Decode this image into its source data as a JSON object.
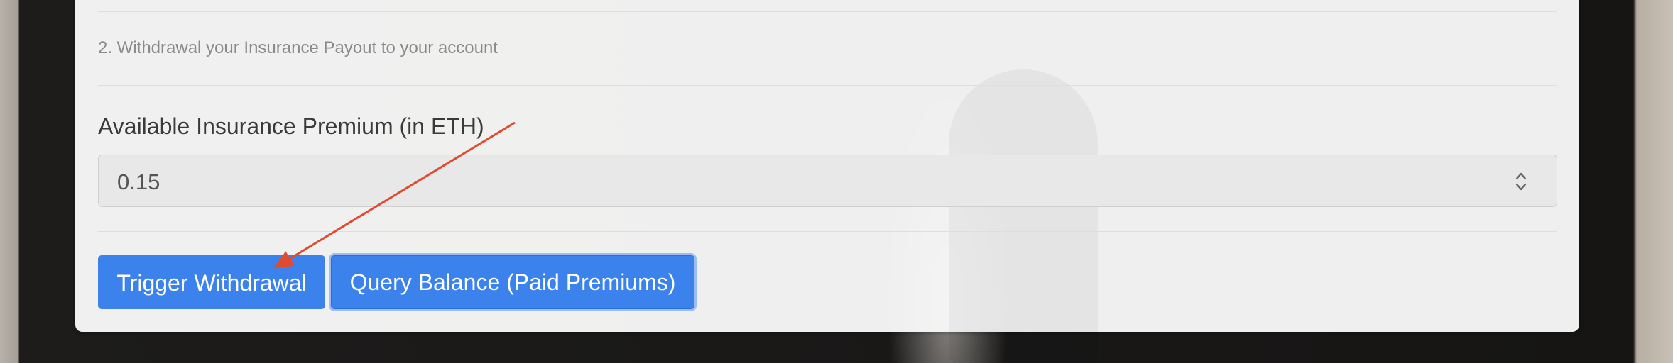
{
  "steps": {
    "step2_text": "2. Withdrawal your Insurance Payout to your account"
  },
  "premium": {
    "label": "Available Insurance Premium (in ETH)",
    "value": "0.15"
  },
  "actions": {
    "trigger_withdrawal_label": "Trigger Withdrawal",
    "query_balance_label": "Query Balance (Paid Premiums)"
  },
  "annotation": {
    "arrow_color": "#e04a2e",
    "target": "trigger-withdrawal-button"
  },
  "colors": {
    "primary_button": "#3b82ec",
    "panel_background": "#f8f8f8"
  },
  "icons": {
    "field_spinner": "chevron-up-down-icon"
  }
}
